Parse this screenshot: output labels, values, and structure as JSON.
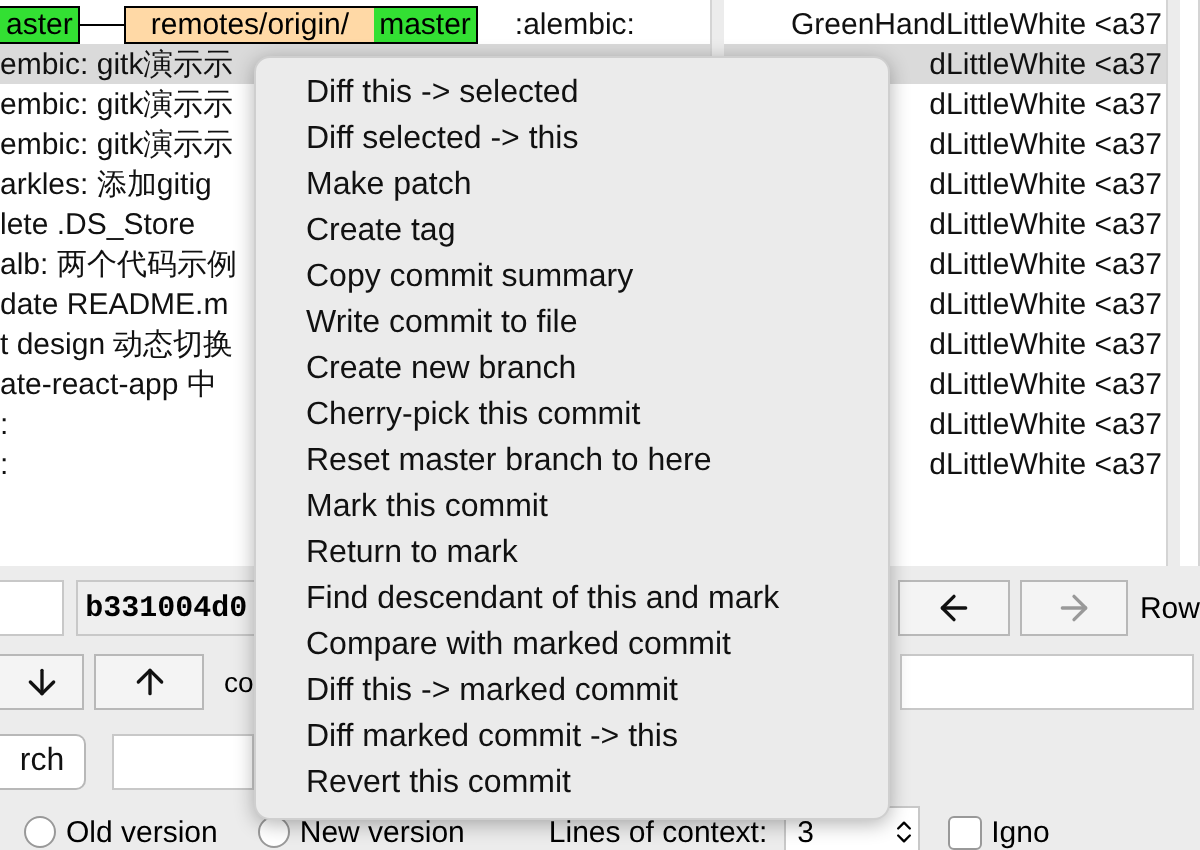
{
  "commit_list": {
    "rows": [
      {
        "tags": [
          {
            "kind": "local",
            "branch": "aster"
          },
          {
            "kind": "remote",
            "prefix": "remotes/origin/",
            "branch": "master"
          }
        ],
        "subject": ":alembic:",
        "selected": false
      },
      {
        "subject": "embic: gitk演示示",
        "selected": true
      },
      {
        "subject": "embic: gitk演示示",
        "selected": false
      },
      {
        "subject": "embic: gitk演示示",
        "selected": false
      },
      {
        "subject": "arkles: 添加gitig",
        "selected": false
      },
      {
        "subject": "lete .DS_Store",
        "selected": false
      },
      {
        "subject": "alb: 两个代码示例",
        "selected": false
      },
      {
        "subject": "date README.m",
        "selected": false
      },
      {
        "subject": "t design 动态切换",
        "selected": false
      },
      {
        "subject": "ate-react-app 中",
        "selected": false
      },
      {
        "subject": ":",
        "selected": false
      },
      {
        "subject": ":",
        "selected": false
      }
    ]
  },
  "author_list": {
    "rows": [
      {
        "text": "GreenHandLittleWhite <a37",
        "selected": false
      },
      {
        "text": "dLittleWhite <a37",
        "selected": true
      },
      {
        "text": "dLittleWhite <a37",
        "selected": false
      },
      {
        "text": "dLittleWhite <a37",
        "selected": false
      },
      {
        "text": "dLittleWhite <a37",
        "selected": false
      },
      {
        "text": "dLittleWhite <a37",
        "selected": false
      },
      {
        "text": "dLittleWhite <a37",
        "selected": false
      },
      {
        "text": "dLittleWhite <a37",
        "selected": false
      },
      {
        "text": "dLittleWhite <a37",
        "selected": false
      },
      {
        "text": "dLittleWhite <a37",
        "selected": false
      },
      {
        "text": "dLittleWhite <a37",
        "selected": false
      },
      {
        "text": "dLittleWhite <a37",
        "selected": false
      }
    ]
  },
  "sha_field": {
    "value": "b331004d0"
  },
  "prev_button": {
    "disabled": false
  },
  "next_button": {
    "disabled": true
  },
  "row_label": "Row",
  "commit_label": "co",
  "search_button": "rch",
  "diff_options": {
    "radios": [
      {
        "label": "Old version",
        "selected": false
      },
      {
        "label": "New version",
        "selected": false
      }
    ],
    "context_label": "Lines of context:",
    "context_value": "3",
    "ignore": {
      "label": "Igno",
      "checked": false
    }
  },
  "context_menu": {
    "items": [
      "Diff this -> selected",
      "Diff selected -> this",
      "Make patch",
      "Create tag",
      "Copy commit summary",
      "Write commit to file",
      "Create new branch",
      "Cherry-pick this commit",
      "Reset master branch to here",
      "Mark this commit",
      "Return to mark",
      "Find descendant of this and mark",
      "Compare with marked commit",
      "Diff this -> marked commit",
      "Diff marked commit -> this",
      "Revert this commit"
    ]
  }
}
